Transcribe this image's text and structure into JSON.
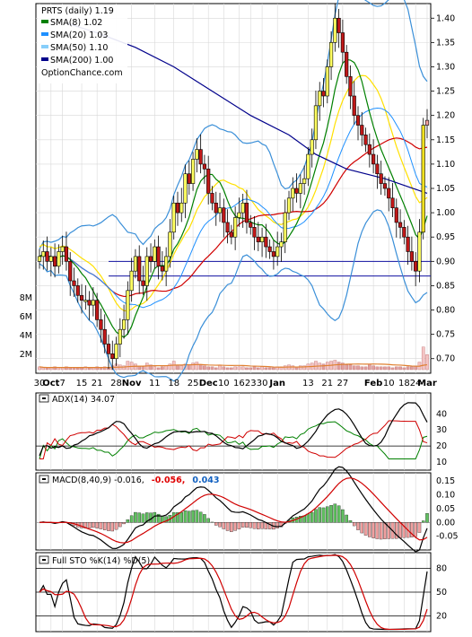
{
  "chart_data": {
    "type": "candlestick",
    "ticker": "PRTS",
    "period": "daily",
    "last_value": "1.19",
    "watermark": "OptionChance.com",
    "x_labels": [
      "30",
      "Oct",
      "7",
      "15",
      "21",
      "28",
      "Nov",
      "11",
      "18",
      "25",
      "Dec",
      "10",
      "16",
      "23",
      "30",
      "Jan",
      "13",
      "21",
      "27",
      "Feb",
      "10",
      "18",
      "24",
      "Mar"
    ],
    "price_panel": {
      "ylim": [
        0.67,
        1.43
      ],
      "yticks": [
        "1.40",
        "1.35",
        "1.30",
        "1.25",
        "1.20",
        "1.15",
        "1.10",
        "1.05",
        "1.00",
        "0.95",
        "0.90",
        "0.85",
        "0.80",
        "0.75",
        "0.70"
      ],
      "volume_ticks": [
        "8M",
        "6M",
        "4M",
        "2M"
      ],
      "legend": [
        {
          "label": "PRTS (daily) 1.19",
          "color": ""
        },
        {
          "label": "SMA(8) 1.02",
          "color": "#008000"
        },
        {
          "label": "SMA(20) 1.03",
          "color": "#1e90ff"
        },
        {
          "label": "SMA(50) 1.10",
          "color": "#87cefa"
        },
        {
          "label": "SMA(200) 1.00",
          "color": "#00008b"
        }
      ],
      "close": [
        0.91,
        0.92,
        0.9,
        0.91,
        0.89,
        0.92,
        0.93,
        0.9,
        0.86,
        0.85,
        0.83,
        0.82,
        0.82,
        0.81,
        0.82,
        0.78,
        0.76,
        0.73,
        0.71,
        0.7,
        0.73,
        0.76,
        0.78,
        0.84,
        0.88,
        0.91,
        0.86,
        0.85,
        0.91,
        0.9,
        0.93,
        0.89,
        0.88,
        0.91,
        0.96,
        1.02,
        1.0,
        1.02,
        1.08,
        1.06,
        1.11,
        1.13,
        1.1,
        1.09,
        1.04,
        1.02,
        1.0,
        1.01,
        0.98,
        0.96,
        0.95,
        0.99,
        1.0,
        1.02,
        0.98,
        0.97,
        0.95,
        0.94,
        0.95,
        0.93,
        0.92,
        0.91,
        0.93,
        0.94,
        1.0,
        1.03,
        1.05,
        1.04,
        1.06,
        1.07,
        1.12,
        1.15,
        1.22,
        1.25,
        1.24,
        1.3,
        1.35,
        1.4,
        1.37,
        1.33,
        1.28,
        1.24,
        1.2,
        1.18,
        1.16,
        1.14,
        1.12,
        1.1,
        1.08,
        1.06,
        1.05,
        1.03,
        1.01,
        0.98,
        0.97,
        0.95,
        0.92,
        0.9,
        0.88,
        0.96,
        1.18,
        1.19
      ],
      "volume_m": [
        0.3,
        0.2,
        0.2,
        0.2,
        0.3,
        0.2,
        0.2,
        0.3,
        0.2,
        0.2,
        0.2,
        0.2,
        0.3,
        0.2,
        0.2,
        0.3,
        0.2,
        0.3,
        0.2,
        0.4,
        0.6,
        0.5,
        0.4,
        0.9,
        0.8,
        0.6,
        0.4,
        0.3,
        0.7,
        0.5,
        0.3,
        0.2,
        0.3,
        0.4,
        0.6,
        0.9,
        0.5,
        0.4,
        0.6,
        0.5,
        0.7,
        0.8,
        0.5,
        0.4,
        0.3,
        0.3,
        0.2,
        0.5,
        0.3,
        0.2,
        0.2,
        0.3,
        0.3,
        0.3,
        0.2,
        0.2,
        0.3,
        0.2,
        0.3,
        0.2,
        0.2,
        0.2,
        0.3,
        0.3,
        0.4,
        0.5,
        0.4,
        0.3,
        0.4,
        0.4,
        0.6,
        0.7,
        0.9,
        0.7,
        0.6,
        0.8,
        0.9,
        1.0,
        0.8,
        0.7,
        0.5,
        0.5,
        0.4,
        0.4,
        0.3,
        0.3,
        0.6,
        0.4,
        0.3,
        0.3,
        0.3,
        0.3,
        0.2,
        0.3,
        0.3,
        0.2,
        0.3,
        0.3,
        0.4,
        0.8,
        2.4,
        1.6
      ],
      "sma200": [
        [
          7,
          1.39
        ],
        [
          15,
          1.37
        ],
        [
          25,
          1.34
        ],
        [
          35,
          1.3
        ],
        [
          45,
          1.25
        ],
        [
          55,
          1.2
        ],
        [
          65,
          1.16
        ],
        [
          72,
          1.12
        ],
        [
          80,
          1.09
        ],
        [
          90,
          1.07
        ],
        [
          101,
          1.04
        ]
      ],
      "horizontal_lines": [
        0.9,
        0.87
      ]
    },
    "adx_panel": {
      "label": "ADX(14) 34.07",
      "ylim": [
        5,
        53
      ],
      "yticks": [
        "40",
        "30",
        "20",
        "10"
      ]
    },
    "macd_panel": {
      "label": "MACD(8,40,9) -0.016,",
      "macd_value": "-0.056,",
      "signal_value": "0.043",
      "ylim": [
        -0.1,
        0.18
      ],
      "yticks": [
        "0.15",
        "0.10",
        "0.05",
        "0.00",
        "-0.05"
      ]
    },
    "sto_panel": {
      "label": "Full STO %K(14) %D(5)",
      "ylim": [
        0,
        100
      ],
      "yticks": [
        "80",
        "50",
        "20"
      ]
    }
  }
}
